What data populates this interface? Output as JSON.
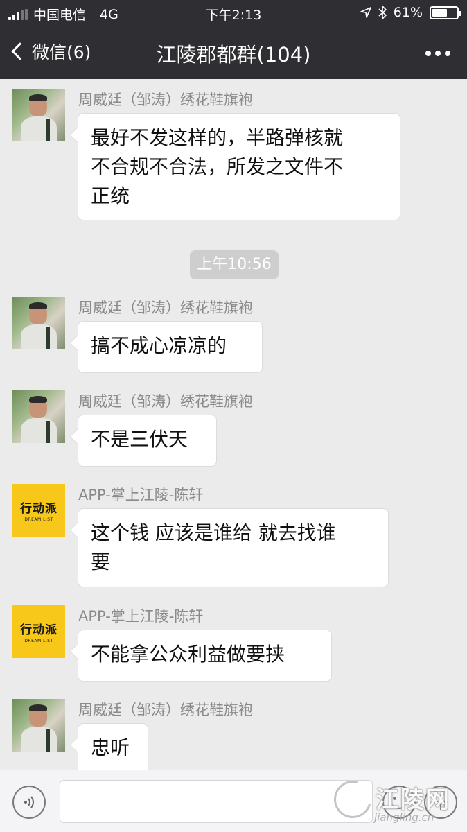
{
  "status_bar": {
    "carrier": "中国电信",
    "network": "4G",
    "time": "下午2:13",
    "battery_percent": "61%",
    "battery_level": 0.61
  },
  "nav": {
    "back_label": "微信(6)",
    "title": "江陵郡都群(104)"
  },
  "messages": [
    {
      "sender": "周威廷（邹涛）绣花鞋旗袍",
      "text": "最好不发这样的，半路弹核就\n不合规不合法，所发之文件不\n正统"
    },
    {
      "sender": "周威廷（邹涛）绣花鞋旗袍",
      "text": "搞不成心凉凉的"
    },
    {
      "sender": "周威廷（邹涛）绣花鞋旗袍",
      "text": "不是三伏天"
    },
    {
      "sender": "APP-掌上江陵-陈轩",
      "text": "这个钱 应该是谁给 就去找谁\n要"
    },
    {
      "sender": "APP-掌上江陵-陈轩",
      "text": "不能拿公众利益做要挟"
    },
    {
      "sender": "周威廷（邹涛）绣花鞋旗袍",
      "text": "忠听"
    }
  ],
  "timestamp": "上午10:56",
  "brand_avatar": {
    "main": "行动派",
    "sub": "DREAM LIST"
  },
  "watermark": {
    "title": "江陵网",
    "url": "jiangling.cn"
  },
  "colors": {
    "header_bg": "#2e2e33",
    "chat_bg": "#ebebeb",
    "bubble_bg": "#ffffff",
    "brand_yellow": "#f7c719"
  },
  "icons": {
    "voice": "voice-icon",
    "emoji": "emoji-icon",
    "plus": "plus-icon",
    "more": "more-icon",
    "back": "chevron-left-icon"
  }
}
